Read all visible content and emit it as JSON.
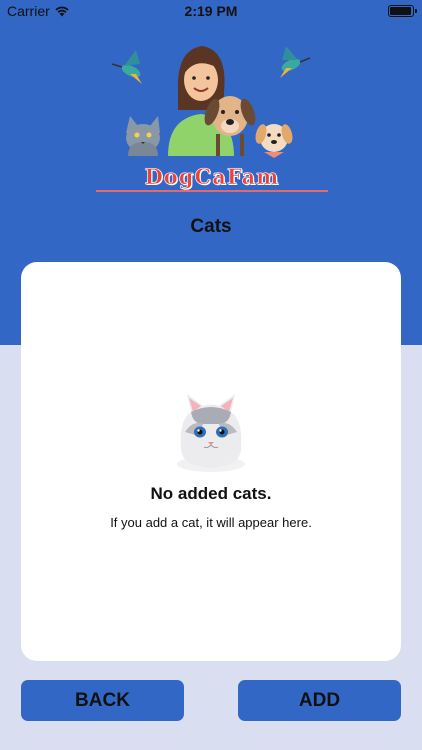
{
  "status_bar": {
    "carrier": "Carrier",
    "time": "2:19 PM",
    "battery_level": 0.95
  },
  "logo": {
    "text": "DogCaFam",
    "icon": "dogcafam-logo-illustration"
  },
  "header": {
    "title": "Cats"
  },
  "empty_state": {
    "icon": "cat-face-icon",
    "title": "No added cats.",
    "subtitle": "If you add a cat, it will appear here."
  },
  "footer": {
    "back_label": "BACK",
    "add_label": "ADD"
  },
  "colors": {
    "primary": "#3367c6",
    "background": "#d9dff0",
    "card": "#ffffff",
    "logo_text": "#e8443b"
  }
}
